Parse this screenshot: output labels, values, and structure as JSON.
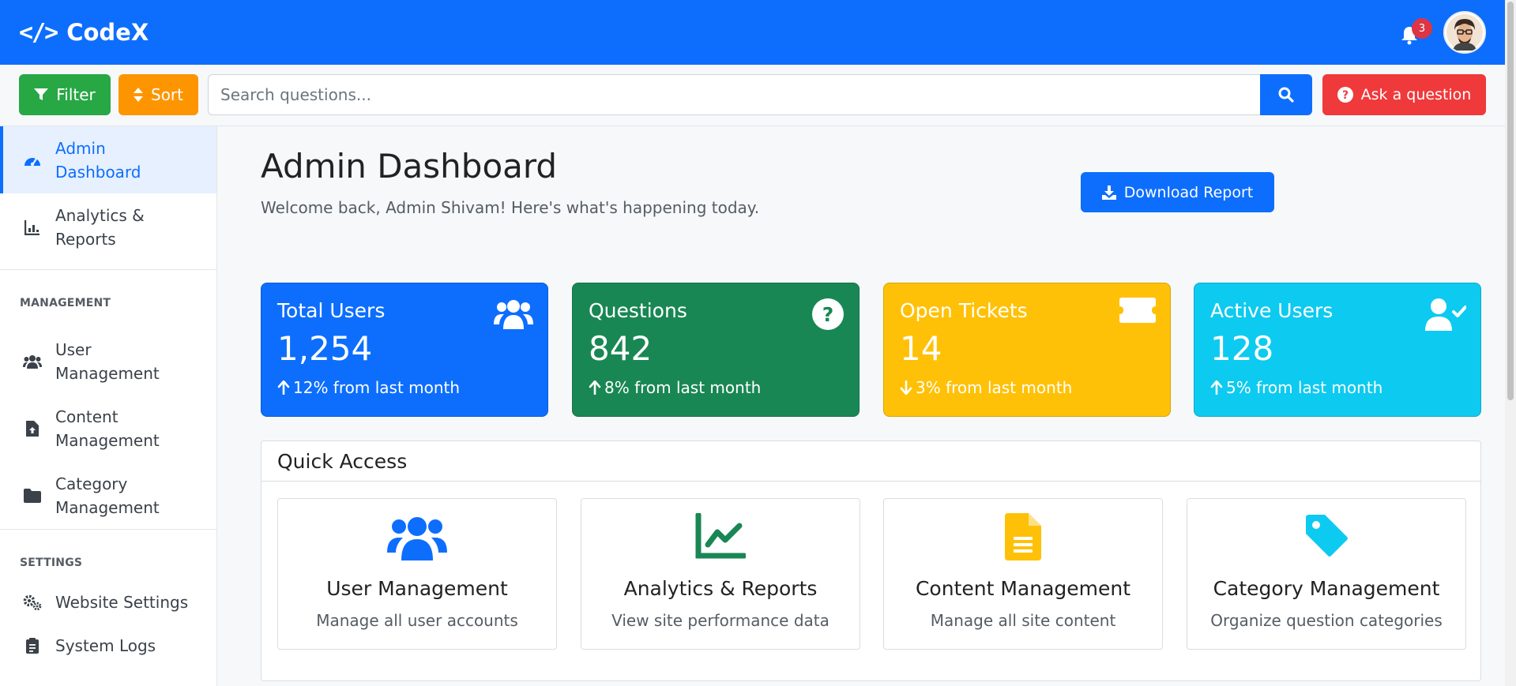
{
  "app": {
    "brand_name": "CodeX",
    "brand_icon": "code-icon"
  },
  "navbar": {
    "notification_count": "3"
  },
  "toolbar": {
    "filter_label": "Filter",
    "sort_label": "Sort",
    "search_placeholder": "Search questions...",
    "search_value": "",
    "ask_label": "Ask a question"
  },
  "sidebar": {
    "items": [
      {
        "label": "Admin Dashboard",
        "icon": "gauge-icon",
        "active": true
      },
      {
        "label": "Analytics & Reports",
        "icon": "chart-icon",
        "active": false
      }
    ],
    "management_heading": "MANAGEMENT",
    "management_items": [
      {
        "label": "User Management",
        "icon": "users-icon"
      },
      {
        "label": "Content Management",
        "icon": "file-upload-icon"
      },
      {
        "label": "Category Management",
        "icon": "folder-icon"
      }
    ],
    "settings_heading": "SETTINGS",
    "settings_items": [
      {
        "label": "Website Settings",
        "icon": "gears-icon"
      },
      {
        "label": "System Logs",
        "icon": "clipboard-icon"
      }
    ]
  },
  "main": {
    "title": "Admin Dashboard",
    "subtitle": "Welcome back, Admin Shivam! Here's what's happening today.",
    "download_label": "Download Report",
    "stats": [
      {
        "label": "Total Users",
        "value": "1,254",
        "change": "12% from last month",
        "direction": "up",
        "color": "#0d6efd",
        "icon": "users-icon"
      },
      {
        "label": "Questions",
        "value": "842",
        "change": "8% from last month",
        "direction": "up",
        "color": "#198754",
        "icon": "question-circle-icon"
      },
      {
        "label": "Open Tickets",
        "value": "14",
        "change": "3% from last month",
        "direction": "down",
        "color": "#ffc107",
        "icon": "ticket-icon"
      },
      {
        "label": "Active Users",
        "value": "128",
        "change": "5% from last month",
        "direction": "up",
        "color": "#0dcaf0",
        "icon": "user-check-icon"
      }
    ],
    "quick_access": {
      "heading": "Quick Access",
      "cards": [
        {
          "title": "User Management",
          "desc": "Manage all user accounts",
          "icon": "users-icon",
          "color": "#0d6efd"
        },
        {
          "title": "Analytics & Reports",
          "desc": "View site performance data",
          "icon": "chart-line-icon",
          "color": "#198754"
        },
        {
          "title": "Content Management",
          "desc": "Manage all site content",
          "icon": "file-icon",
          "color": "#ffc107"
        },
        {
          "title": "Category Management",
          "desc": "Organize question categories",
          "icon": "tag-icon",
          "color": "#0dcaf0"
        }
      ]
    }
  }
}
